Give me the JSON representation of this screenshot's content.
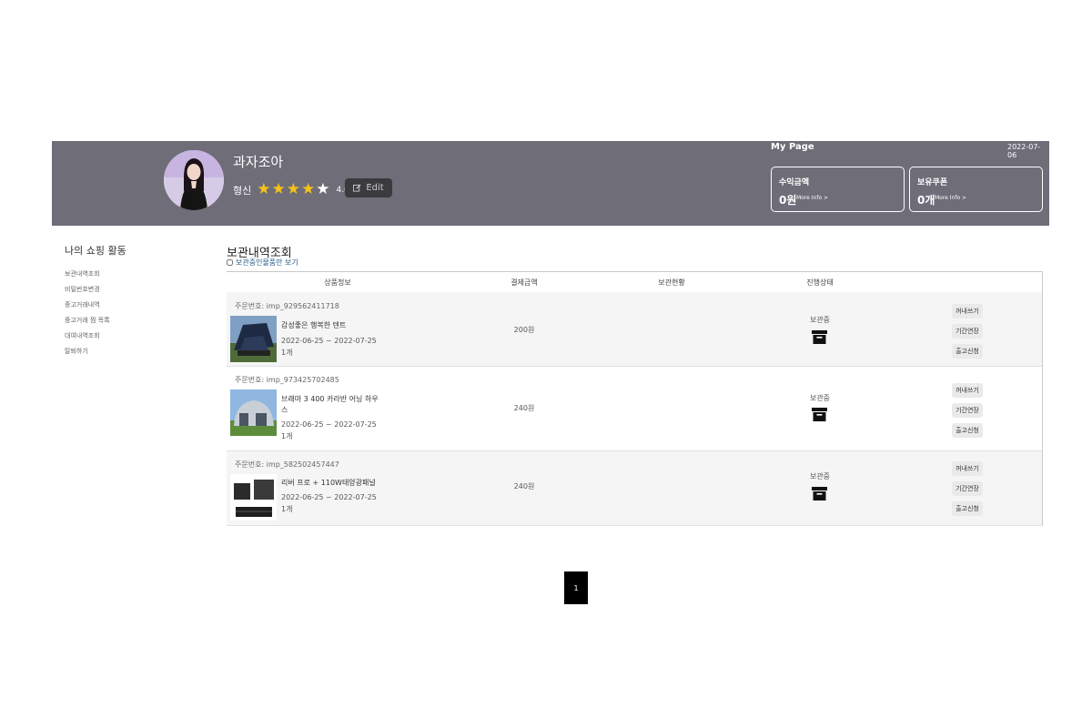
{
  "header": {
    "username": "과자조아",
    "grade": "형신",
    "rating": "4.0",
    "rating_value": 4.0,
    "edit_label": "Edit",
    "mypage_title": "My Page",
    "date": "2022-07-06",
    "cards": [
      {
        "title": "수익금액",
        "value": "0원",
        "more": "More Info >"
      },
      {
        "title": "보유쿠폰",
        "value": "0개",
        "more": "More Info >"
      }
    ],
    "colors": {
      "band": "#6e6d78",
      "star": "#f4c21b"
    }
  },
  "sidebar": {
    "title": "나의 쇼핑 활동",
    "items": [
      "보관내역조회",
      "비밀번호변경",
      "중고거래내역",
      "중고거래 찜 목록",
      "대여내역조회",
      "탈퇴하기"
    ]
  },
  "main": {
    "title": "보관내역조회",
    "filter_label": "보관중인물품만 보기",
    "columns": [
      "상품정보",
      "결제금액",
      "보관현황",
      "진행상태"
    ],
    "orders": [
      {
        "order_no": "주문번호: imp_929562411718",
        "product": "감성좋은 행복한 텐트",
        "period": "2022-06-25 ~ 2022-07-25",
        "qty": "1개",
        "price": "200원",
        "status": "보관중",
        "actions": [
          "꺼내쓰기",
          "기간연장",
          "출고신청"
        ]
      },
      {
        "order_no": "주문번호: imp_973425702485",
        "product": "브래마 3 400 카라반 어닝 하우스",
        "period": "2022-06-25 ~ 2022-07-25",
        "qty": "1개",
        "price": "240원",
        "status": "보관중",
        "actions": [
          "꺼내쓰기",
          "기간연장",
          "출고신청"
        ]
      },
      {
        "order_no": "주문번호: imp_582502457447",
        "product": "리버 프로 + 110W태양광패널",
        "period": "2022-06-25 ~ 2022-07-25",
        "qty": "1개",
        "price": "240원",
        "status": "보관중",
        "actions": [
          "꺼내쓰기",
          "기간연장",
          "출고신청"
        ]
      }
    ]
  },
  "pagination": {
    "current": "1"
  },
  "icons": [
    "edit-icon",
    "star-icon",
    "archive-box-icon",
    "checkbox-icon"
  ]
}
